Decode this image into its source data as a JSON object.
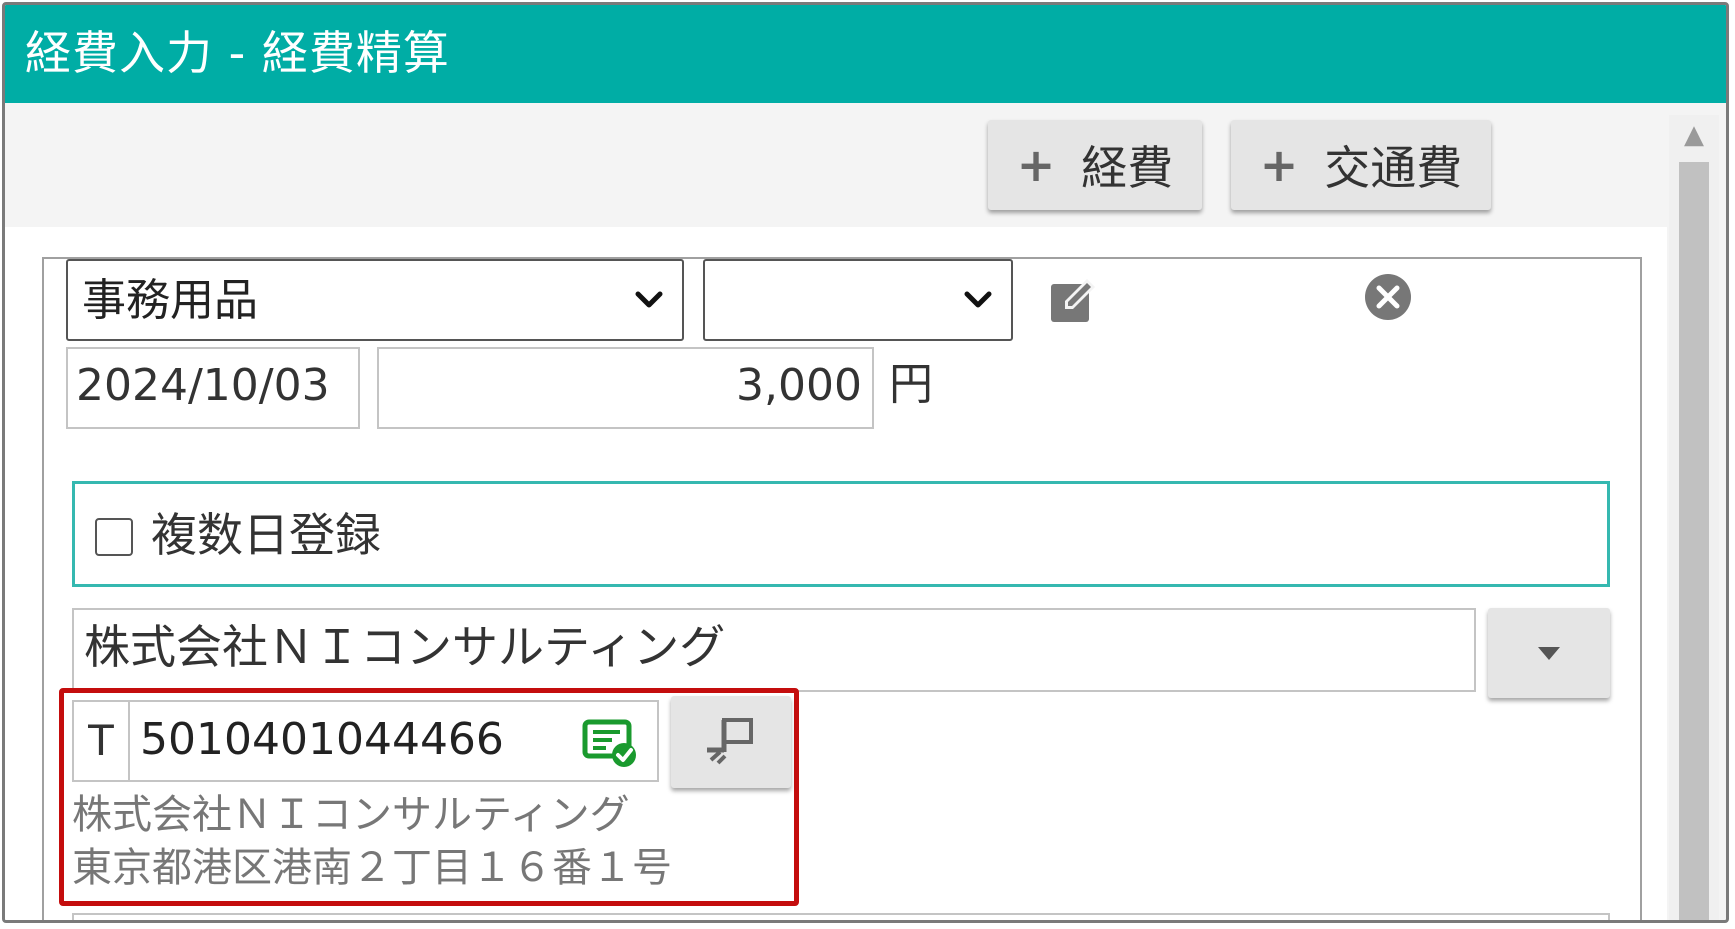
{
  "window": {
    "title": "経費入力 - 経費精算"
  },
  "toolbar": {
    "add_expense_label": "経費",
    "add_transport_label": "交通費",
    "plus_icon": "plus-icon"
  },
  "expense": {
    "category_selected": "事務用品",
    "subcategory_selected": "",
    "date_value": "2024/10/03",
    "amount_value": "3,000",
    "currency_unit": "円",
    "multi_day_label": "複数日登録",
    "multi_day_checked": false,
    "vendor_value": "株式会社ＮＩコンサルティング",
    "invoice": {
      "prefix": "T",
      "registration_number": "5010401044466",
      "verified": true,
      "company_name": "株式会社ＮＩコンサルティング",
      "address": "東京都港区港南２丁目１６番１号"
    }
  },
  "icons": {
    "edit": "edit-icon",
    "delete": "close-circle-icon",
    "verify": "verified-icon",
    "lookup": "lookup-flag-icon"
  },
  "colors": {
    "title_bar": "#00ada5",
    "highlight": "#c40d0d",
    "verify_green": "#1a9a2e",
    "multi_day_border": "#35b8b0"
  }
}
